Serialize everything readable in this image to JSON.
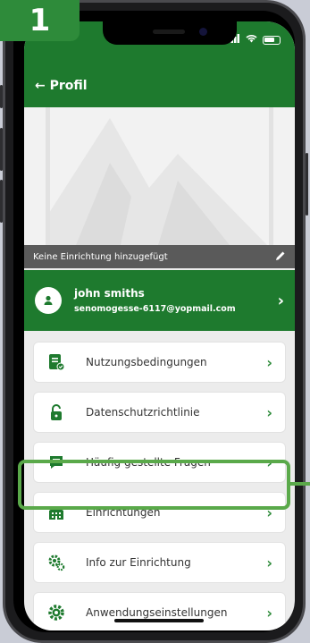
{
  "step_badge": "1",
  "header": {
    "back_label": "← Profil"
  },
  "cover": {
    "caption": "Keine Einrichtung hinzugefügt",
    "edit_icon": "pencil-icon",
    "placeholder_icon": "image-placeholder-icon"
  },
  "profile": {
    "name": "john smiths",
    "email": "senomogesse-6117@yopmail.com",
    "avatar_icon": "user-icon"
  },
  "menu": [
    {
      "label": "Nutzungsbedingungen",
      "icon": "document-check-icon"
    },
    {
      "label": "Datenschutzrichtlinie",
      "icon": "lock-icon"
    },
    {
      "label": "Häufig gestellte Fragen",
      "icon": "chat-bubble-icon"
    },
    {
      "label": "Einrichtungen",
      "icon": "building-icon"
    },
    {
      "label": "Info zur Einrichtung",
      "icon": "gears-icon"
    },
    {
      "label": "Anwendungseinstellungen",
      "icon": "settings-gear-icon"
    }
  ],
  "colors": {
    "primary_green": "#1e7a2e",
    "highlight_green": "#5aa94a",
    "badge_green": "#2e8b3a"
  }
}
